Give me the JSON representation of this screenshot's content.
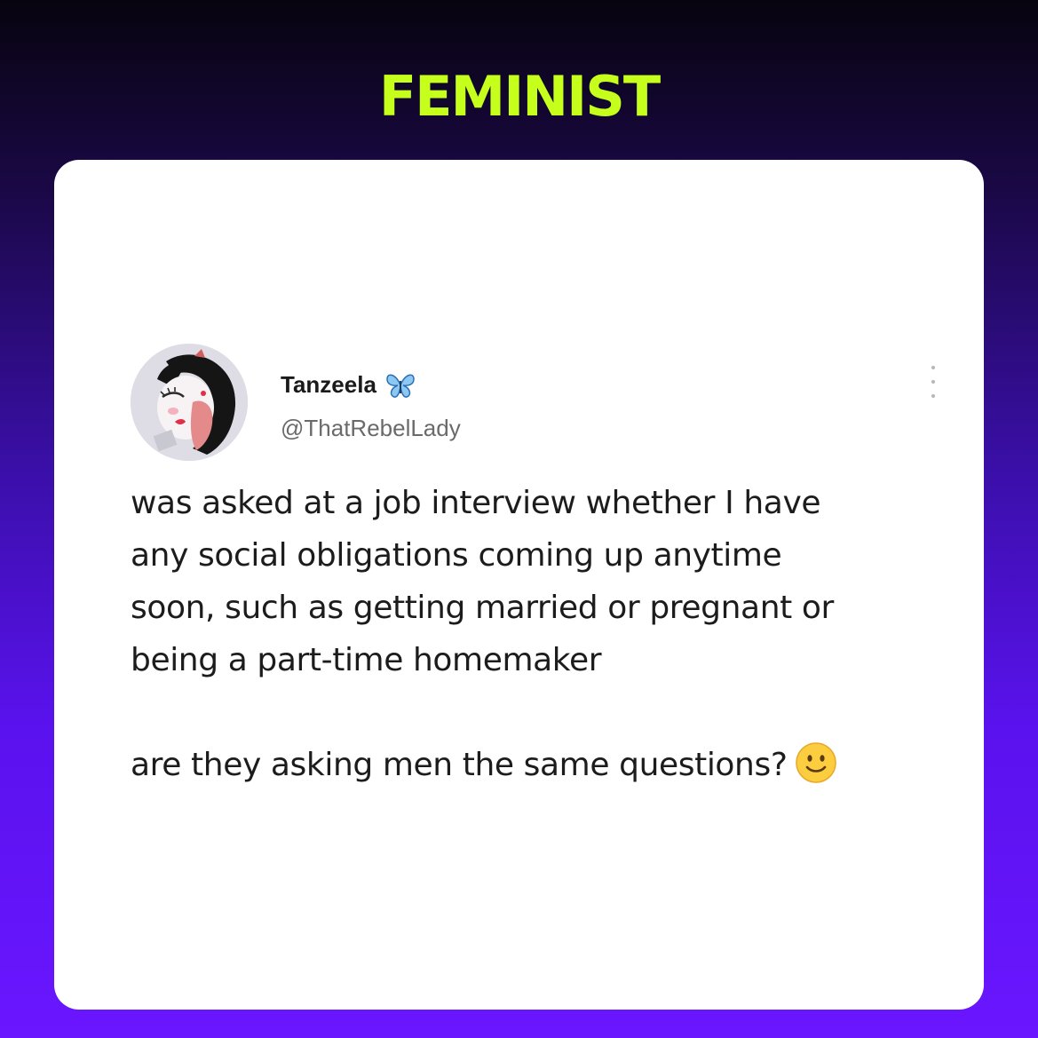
{
  "headline": "FEMINIST",
  "tweet": {
    "author": {
      "display_name": "Tanzeela",
      "badge_icon": "butterfly-icon",
      "handle": "@ThatRebelLady"
    },
    "text_lines": [
      "was asked at a job interview whether I have",
      "any social obligations coming up anytime",
      "soon, such as getting married or pregnant or",
      "being a part-time homemaker"
    ],
    "second_paragraph": "are they asking men the same questions?",
    "emoji_icon": "slightly-smiling-face-icon"
  },
  "colors": {
    "headline": "#c6ff1c",
    "background_top": "#07040f",
    "background_bottom": "#6a16ff",
    "card": "#ffffff",
    "butterfly": "#4aa3e8"
  }
}
